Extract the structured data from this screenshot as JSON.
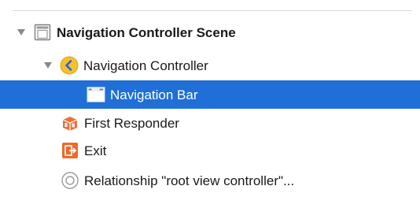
{
  "outline": {
    "scene": {
      "label": "Navigation Controller Scene",
      "icon": "scene-icon",
      "expanded": true
    },
    "navigation_controller": {
      "label": "Navigation Controller",
      "icon": "navigation-controller-icon",
      "expanded": true
    },
    "navigation_bar": {
      "label": "Navigation Bar",
      "icon": "navigation-bar-icon",
      "selected": true
    },
    "first_responder": {
      "label": "First Responder",
      "icon": "first-responder-icon"
    },
    "exit": {
      "label": "Exit",
      "icon": "exit-icon"
    },
    "relationship": {
      "label": "Relationship \"root view controller\"...",
      "icon": "relationship-icon"
    }
  },
  "colors": {
    "selection": "#1f6fd6",
    "nav_controller_yellow": "#f5c02c",
    "first_responder_orange": "#e8743b",
    "exit_orange": "#ec6a2c"
  }
}
